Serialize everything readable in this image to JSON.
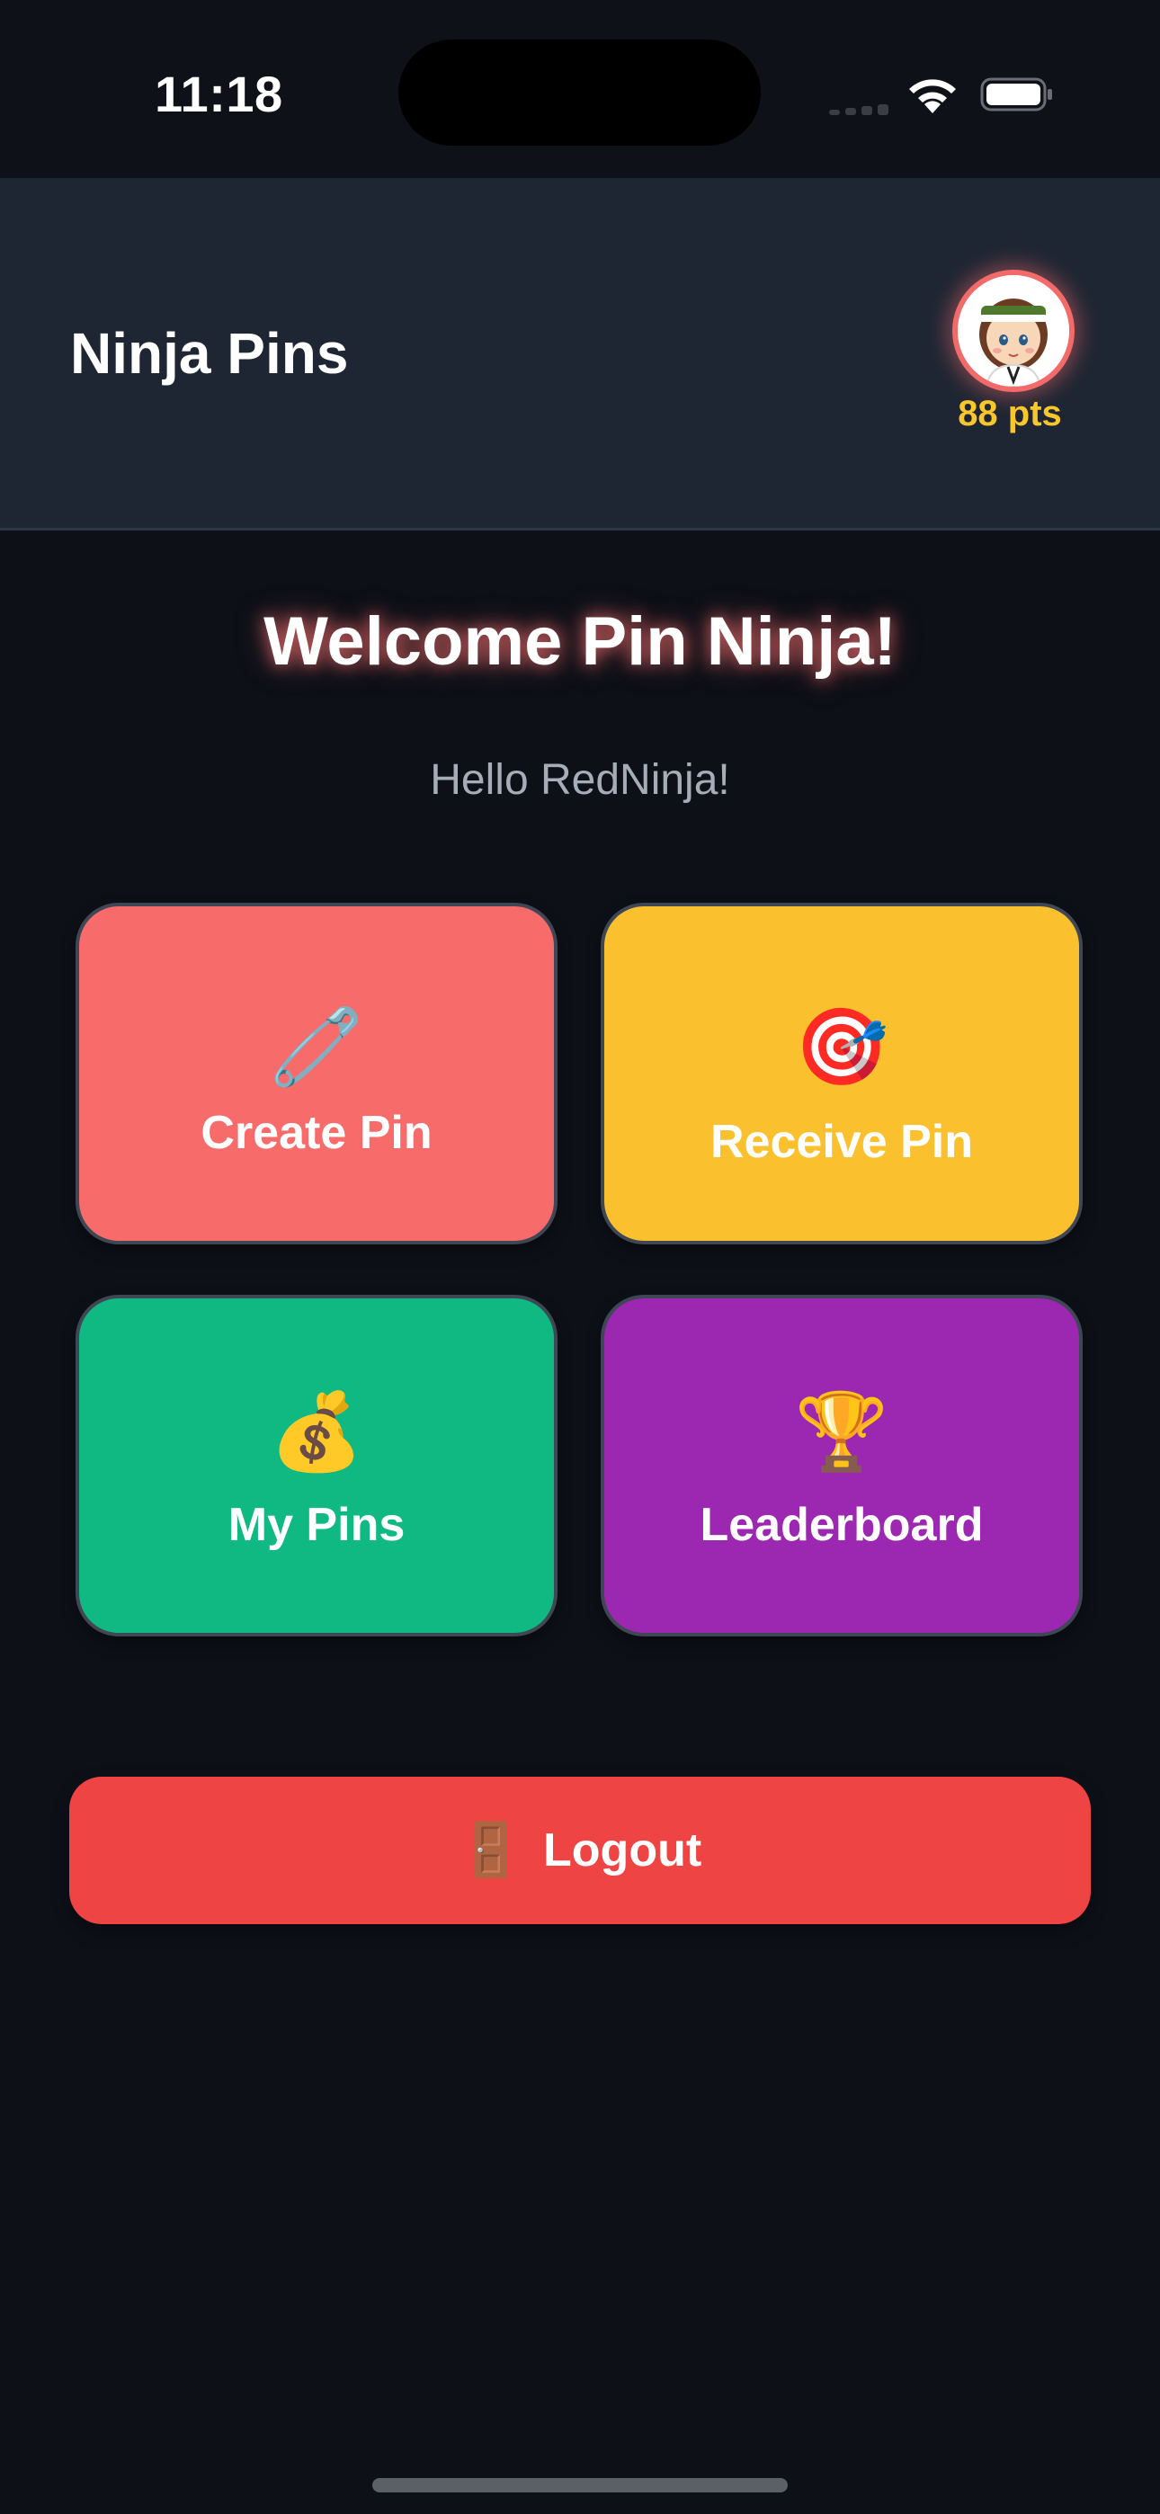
{
  "status_bar": {
    "time": "11:18"
  },
  "header": {
    "title": "Ninja Pins",
    "points": "88 pts",
    "avatar_icon": "ninja-avatar"
  },
  "main": {
    "welcome": "Welcome Pin Ninja!",
    "greeting": "Hello RedNinja!"
  },
  "tiles": [
    {
      "label": "Create Pin",
      "icon": "🧷",
      "icon_name": "clothespin-icon",
      "color": "#f76b6b"
    },
    {
      "label": "Receive Pin",
      "icon": "🎯",
      "icon_name": "target-icon",
      "color": "#fbc02d"
    },
    {
      "label": "My Pins",
      "icon": "💰",
      "icon_name": "money-bag-icon",
      "color": "#10b981"
    },
    {
      "label": "Leaderboard",
      "icon": "🏆",
      "icon_name": "trophy-icon",
      "color": "#9c27b0"
    }
  ],
  "logout": {
    "label": "Logout",
    "icon": "🚪",
    "icon_name": "door-icon",
    "color": "#ef4444"
  },
  "colors": {
    "background": "#0d1017",
    "header": "#1f2633",
    "points": "#f8c62d",
    "avatar_ring": "#f26b6b"
  }
}
